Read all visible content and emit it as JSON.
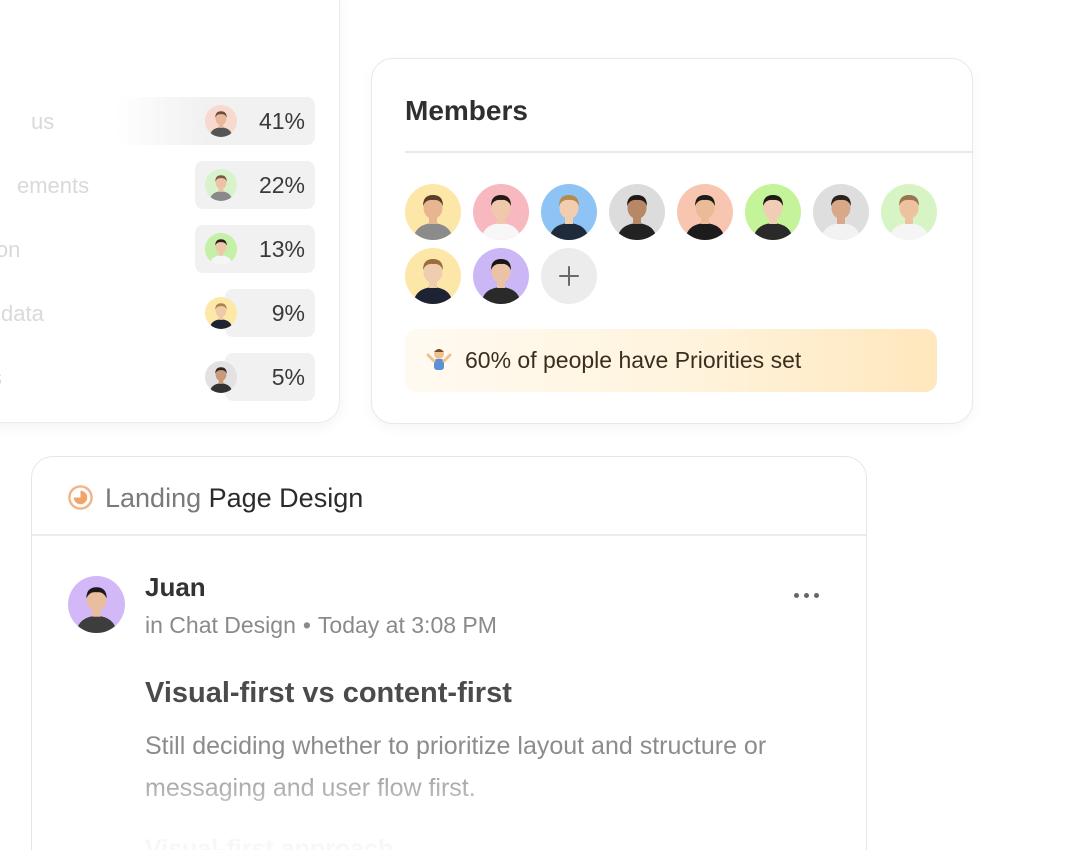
{
  "stats": {
    "rows": [
      {
        "label": "us",
        "pct": "41%",
        "avatar_bg": "#f7d9cf",
        "skin": "#e9b89c",
        "hair": "#6b4b3a",
        "shirt": "#555"
      },
      {
        "label": "ements",
        "pct": "22%",
        "avatar_bg": "#d8f2cc",
        "skin": "#ecc3a6",
        "hair": "#7b5a44",
        "shirt": "#8a8a8a"
      },
      {
        "label": "ion",
        "pct": "13%",
        "avatar_bg": "#c5f0a8",
        "skin": "#efc7ab",
        "hair": "#2a211b",
        "shirt": "#f5f5f5"
      },
      {
        "label": "data",
        "pct": "9%",
        "avatar_bg": "#fde8a8",
        "skin": "#efcaa9",
        "hair": "#a8834e",
        "shirt": "#1f2430"
      },
      {
        "label": "s",
        "pct": "5%",
        "avatar_bg": "#e2e2e2",
        "skin": "#c99a7a",
        "hair": "#2c2521",
        "shirt": "#333"
      }
    ]
  },
  "members": {
    "title": "Members",
    "avatars": [
      {
        "name": "member-1",
        "bg": "#fde7a8",
        "skin": "#e7b58f",
        "hair": "#5a3d2a",
        "shirt": "#8b8b8b"
      },
      {
        "name": "member-2",
        "bg": "#f7b8bf",
        "skin": "#f0c9ad",
        "hair": "#241b17",
        "shirt": "#f7f7f7"
      },
      {
        "name": "member-3",
        "bg": "#8ec4f5",
        "skin": "#f2cdb0",
        "hair": "#b48b4f",
        "shirt": "#1f2a3a"
      },
      {
        "name": "member-4",
        "bg": "#dcdcdc",
        "skin": "#b88766",
        "hair": "#1e1a18",
        "shirt": "#222"
      },
      {
        "name": "member-5",
        "bg": "#f8c6b0",
        "skin": "#e9bb96",
        "hair": "#1d1a1a",
        "shirt": "#1c1c1c"
      },
      {
        "name": "member-6",
        "bg": "#c4f39a",
        "skin": "#f0cdb4",
        "hair": "#1f1a18",
        "shirt": "#2a2a2a"
      },
      {
        "name": "member-7",
        "bg": "#dedede",
        "skin": "#d8a889",
        "hair": "#2a221d",
        "shirt": "#f2f2f2"
      },
      {
        "name": "member-8",
        "bg": "#d7f5c4",
        "skin": "#eec1a1",
        "hair": "#9a7650",
        "shirt": "#f5f5f5"
      },
      {
        "name": "member-9",
        "bg": "#fde7a8",
        "skin": "#f1cdb0",
        "hair": "#9a6e3d",
        "shirt": "#1d2333"
      },
      {
        "name": "member-10",
        "bg": "#cbb7f5",
        "skin": "#eac2a5",
        "hair": "#1a1513",
        "shirt": "#2a2a2a"
      }
    ],
    "add_label": "+",
    "banner": {
      "text": "60% of people have Priorities set"
    }
  },
  "post": {
    "project_prefix": "Landing",
    "project_rest": "Page Design",
    "author": "Juan",
    "channel": "in Chat Design",
    "time": "Today at 3:08 PM",
    "title": "Visual-first vs content-first",
    "body": "Still deciding whether to prioritize layout and structure or messaging and user flow first.",
    "subheading": "Visual-first approach",
    "author_avatar": {
      "bg": "#d3b8f7",
      "skin": "#e9bd9d",
      "hair": "#1d1917",
      "shirt": "#3d3d3d"
    }
  },
  "colors": {
    "pie_icon": "#f0a46a",
    "banner_accent": "#ffe3b0"
  }
}
